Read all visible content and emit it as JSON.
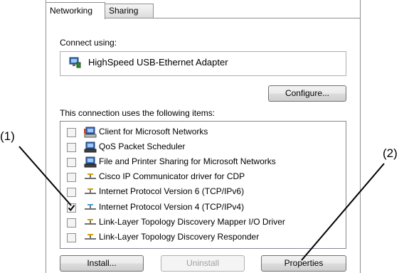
{
  "tabs": [
    {
      "label": "Networking",
      "active": true
    },
    {
      "label": "Sharing",
      "active": false
    }
  ],
  "connect_using": {
    "label": "Connect using:",
    "adapter_name": "HighSpeed USB-Ethernet Adapter",
    "adapter_icon": "network-adapter-icon"
  },
  "buttons": {
    "configure": "Configure...",
    "install": "Install...",
    "uninstall": "Uninstall",
    "properties": "Properties"
  },
  "items_heading": "This connection uses the following items:",
  "items": [
    {
      "label": "Client for Microsoft Networks",
      "checked": false,
      "icon": "network-client-icon"
    },
    {
      "label": "QoS Packet Scheduler",
      "checked": false,
      "icon": "network-service-icon"
    },
    {
      "label": "File and Printer Sharing for Microsoft Networks",
      "checked": false,
      "icon": "network-service-icon"
    },
    {
      "label": "Cisco IP Communicator driver for CDP",
      "checked": false,
      "icon": "protocol-icon"
    },
    {
      "label": "Internet Protocol Version 6 (TCP/IPv6)",
      "checked": false,
      "icon": "protocol-icon"
    },
    {
      "label": "Internet Protocol Version 4 (TCP/IPv4)",
      "checked": true,
      "icon": "protocol-icon"
    },
    {
      "label": "Link-Layer Topology Discovery Mapper I/O Driver",
      "checked": false,
      "icon": "protocol-icon"
    },
    {
      "label": "Link-Layer Topology Discovery Responder",
      "checked": false,
      "icon": "protocol-icon"
    }
  ],
  "callouts": {
    "one": "(1)",
    "two": "(2)"
  }
}
